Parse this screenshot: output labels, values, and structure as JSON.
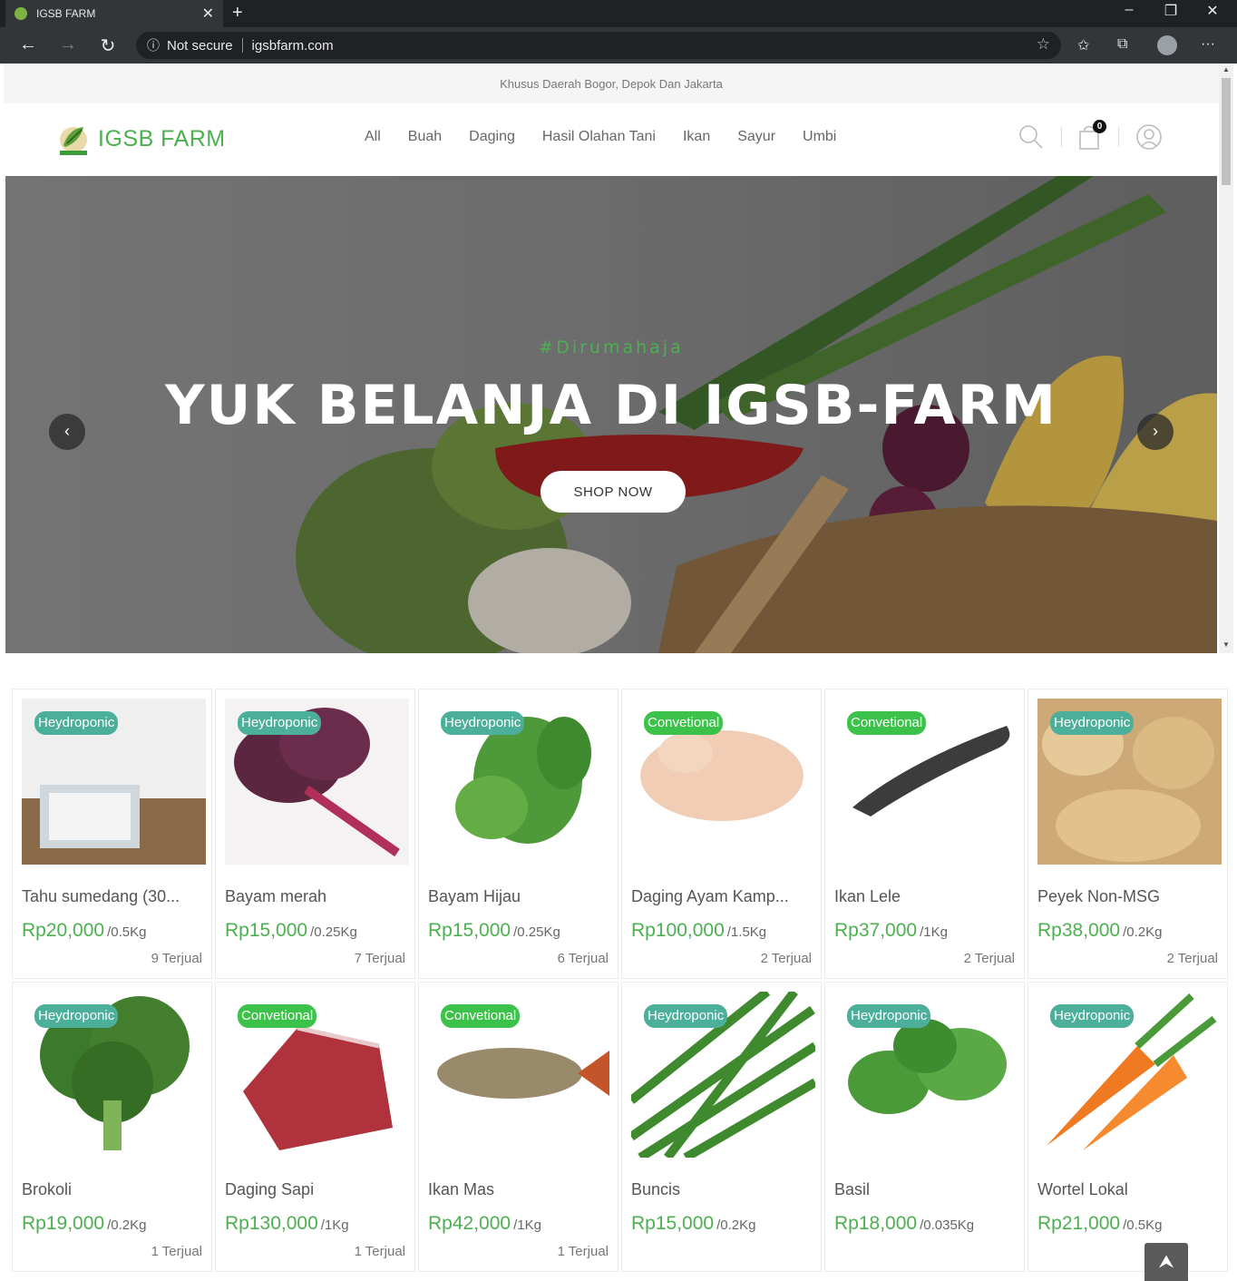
{
  "browser": {
    "tab_title": "IGSB FARM",
    "security_label": "Not secure",
    "url": "igsbfarm.com"
  },
  "topbar": {
    "text": "Khusus Daerah Bogor, Depok Dan Jakarta"
  },
  "header": {
    "brand": "IGSB FARM",
    "menu": [
      "All",
      "Buah",
      "Daging",
      "Hasil Olahan Tani",
      "Ikan",
      "Sayur",
      "Umbi"
    ],
    "cart_count": "0"
  },
  "hero": {
    "tag": "#Dirumahaja",
    "title": "YUK BELANJA DI IGSB-FARM",
    "button": "SHOP NOW"
  },
  "products": [
    {
      "name": "Tahu sumedang (30...",
      "price": "Rp20,000",
      "unit": "/0.5Kg",
      "sold": "9 Terjual",
      "badge": "Heydroponic",
      "badge_type": "hyd",
      "image": "tofu"
    },
    {
      "name": "Bayam merah",
      "price": "Rp15,000",
      "unit": "/0.25Kg",
      "sold": "7 Terjual",
      "badge": "Heydroponic",
      "badge_type": "hyd",
      "image": "red-spinach"
    },
    {
      "name": "Bayam Hijau",
      "price": "Rp15,000",
      "unit": "/0.25Kg",
      "sold": "6 Terjual",
      "badge": "Heydroponic",
      "badge_type": "hyd",
      "image": "green-spinach"
    },
    {
      "name": "Daging Ayam Kamp...",
      "price": "Rp100,000",
      "unit": "/1.5Kg",
      "sold": "2 Terjual",
      "badge": "Convetional",
      "badge_type": "conv",
      "image": "chicken"
    },
    {
      "name": "Ikan Lele",
      "price": "Rp37,000",
      "unit": "/1Kg",
      "sold": "2 Terjual",
      "badge": "Convetional",
      "badge_type": "conv",
      "image": "catfish"
    },
    {
      "name": "Peyek Non-MSG",
      "price": "Rp38,000",
      "unit": "/0.2Kg",
      "sold": "2 Terjual",
      "badge": "Heydroponic",
      "badge_type": "hyd",
      "image": "peyek"
    },
    {
      "name": "Brokoli",
      "price": "Rp19,000",
      "unit": "/0.2Kg",
      "sold": "1 Terjual",
      "badge": "Heydroponic",
      "badge_type": "hyd",
      "image": "broccoli"
    },
    {
      "name": "Daging Sapi",
      "price": "Rp130,000",
      "unit": "/1Kg",
      "sold": "1 Terjual",
      "badge": "Convetional",
      "badge_type": "conv",
      "image": "beef"
    },
    {
      "name": "Ikan Mas",
      "price": "Rp42,000",
      "unit": "/1Kg",
      "sold": "1 Terjual",
      "badge": "Convetional",
      "badge_type": "conv",
      "image": "carp"
    },
    {
      "name": "Buncis",
      "price": "Rp15,000",
      "unit": "/0.2Kg",
      "sold": "",
      "badge": "Heydroponic",
      "badge_type": "hyd",
      "image": "green-beans"
    },
    {
      "name": "Basil",
      "price": "Rp18,000",
      "unit": "/0.035Kg",
      "sold": "",
      "badge": "Heydroponic",
      "badge_type": "hyd",
      "image": "basil"
    },
    {
      "name": "Wortel Lokal",
      "price": "Rp21,000",
      "unit": "/0.5Kg",
      "sold": "",
      "badge": "Heydroponic",
      "badge_type": "hyd",
      "image": "carrot"
    }
  ],
  "colors": {
    "brand_green": "#4caf50",
    "badge_hydroponic": "#4caf9a",
    "badge_conventional": "#3cc24a"
  }
}
